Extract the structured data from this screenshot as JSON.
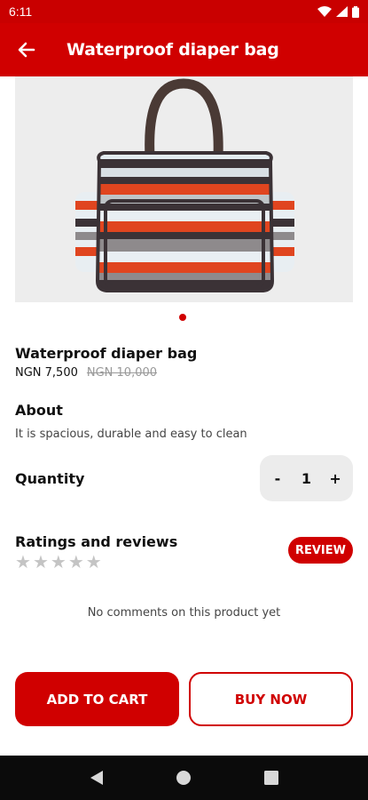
{
  "status_bar": {
    "time": "6:11"
  },
  "app_bar": {
    "title": "Waterproof diaper bag"
  },
  "product": {
    "name": "Waterproof diaper bag",
    "price_current": "NGN 7,500",
    "price_old": "NGN 10,000",
    "image_icon": "diaper-bag-image"
  },
  "about": {
    "heading": "About",
    "text": "It is spacious, durable and easy to clean"
  },
  "quantity": {
    "label": "Quantity",
    "minus": "-",
    "value": "1",
    "plus": "+"
  },
  "ratings": {
    "heading": "Ratings and reviews",
    "stars_filled": 0,
    "stars_total": 5,
    "review_button": "REVIEW"
  },
  "comments": {
    "empty_text": "No comments on this product yet"
  },
  "actions": {
    "add_to_cart": "ADD TO CART",
    "buy_now": "BUY NOW"
  },
  "colors": {
    "brand": "#d00000",
    "status_bar": "#c90000",
    "star_empty": "#c4c4c4"
  }
}
